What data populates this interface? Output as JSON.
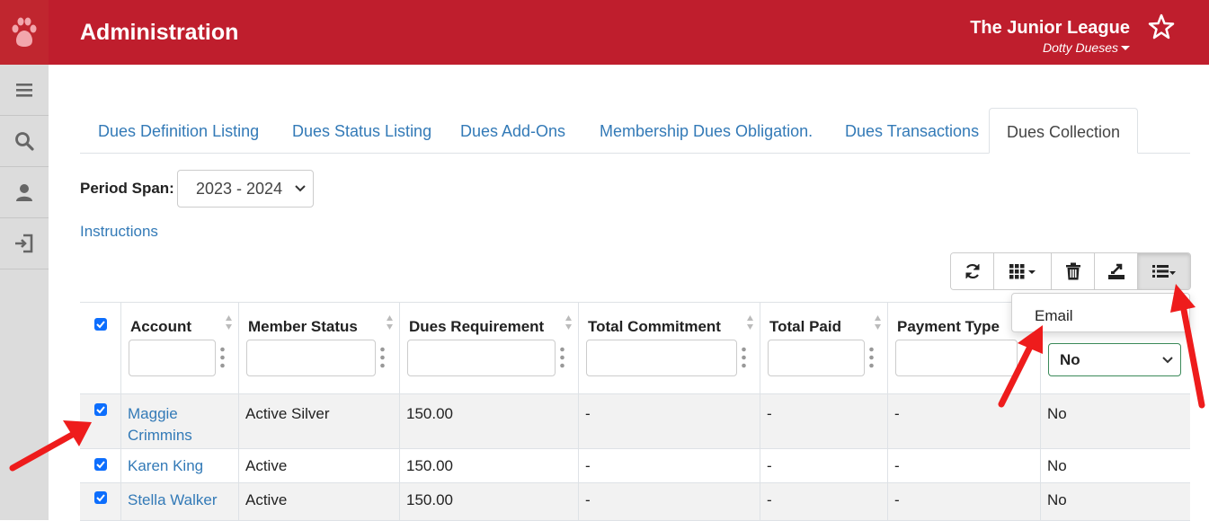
{
  "header": {
    "title": "Administration",
    "org_name": "The Junior League",
    "user_name": "Dotty Dueses",
    "brand_color": "#bf1e2d"
  },
  "sidebar": {
    "items": [
      {
        "icon": "menu-icon"
      },
      {
        "icon": "search-icon"
      },
      {
        "icon": "user-icon"
      },
      {
        "icon": "logout-icon"
      }
    ]
  },
  "tabs": [
    {
      "label": "Dues Definition Listing",
      "active": false
    },
    {
      "label": "Dues Status Listing",
      "active": false
    },
    {
      "label": "Dues Add-Ons",
      "active": false
    },
    {
      "label": "Membership Dues Obligation.",
      "active": false
    },
    {
      "label": "Dues Transactions",
      "active": false
    },
    {
      "label": "Dues Collection",
      "active": true
    }
  ],
  "period": {
    "label": "Period Span:",
    "value": "2023 - 2024"
  },
  "instructions_label": "Instructions",
  "toolbar": {
    "buttons": [
      "refresh-icon",
      "columns-icon",
      "trash-icon",
      "export-icon",
      "list-menu-icon"
    ]
  },
  "menu": {
    "items": [
      "Email"
    ]
  },
  "table": {
    "columns": [
      "Account",
      "Member Status",
      "Dues Requirement",
      "Total Commitment",
      "Total Paid",
      "Payment Type"
    ],
    "last_filter_value": "No",
    "rows": [
      {
        "checked": true,
        "account": "Maggie Crimmins",
        "status": "Active Silver",
        "dues": "150.00",
        "commitment": "-",
        "paid": "-",
        "payment_type": "-",
        "last": "No"
      },
      {
        "checked": true,
        "account": "Karen King",
        "status": "Active",
        "dues": "150.00",
        "commitment": "-",
        "paid": "-",
        "payment_type": "-",
        "last": "No"
      },
      {
        "checked": true,
        "account": "Stella Walker",
        "status": "Active",
        "dues": "150.00",
        "commitment": "-",
        "paid": "-",
        "payment_type": "-",
        "last": "No"
      }
    ]
  }
}
